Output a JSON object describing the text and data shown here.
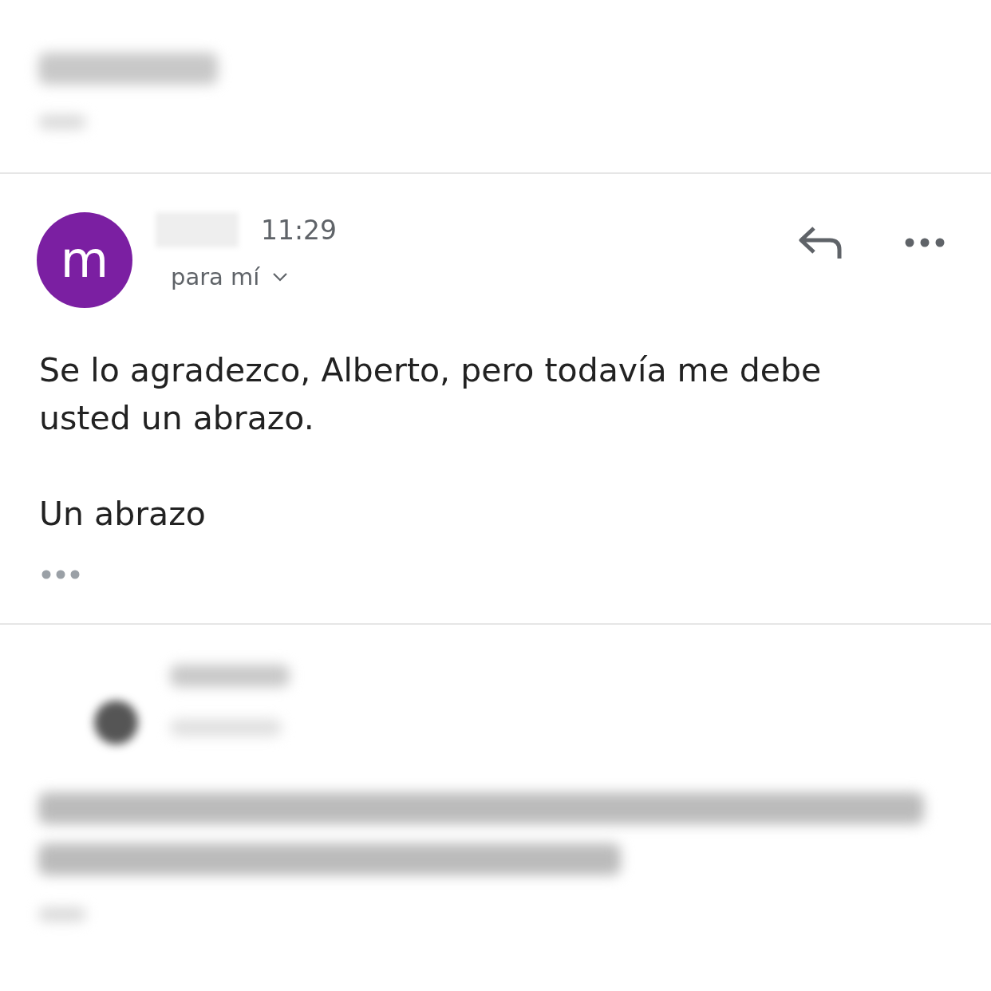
{
  "message": {
    "avatar_letter": "m",
    "time": "11:29",
    "recipient": "para mí",
    "body": [
      "Se lo agradezco, Alberto, pero todavía me debe usted un abrazo.",
      "Un abrazo"
    ]
  }
}
